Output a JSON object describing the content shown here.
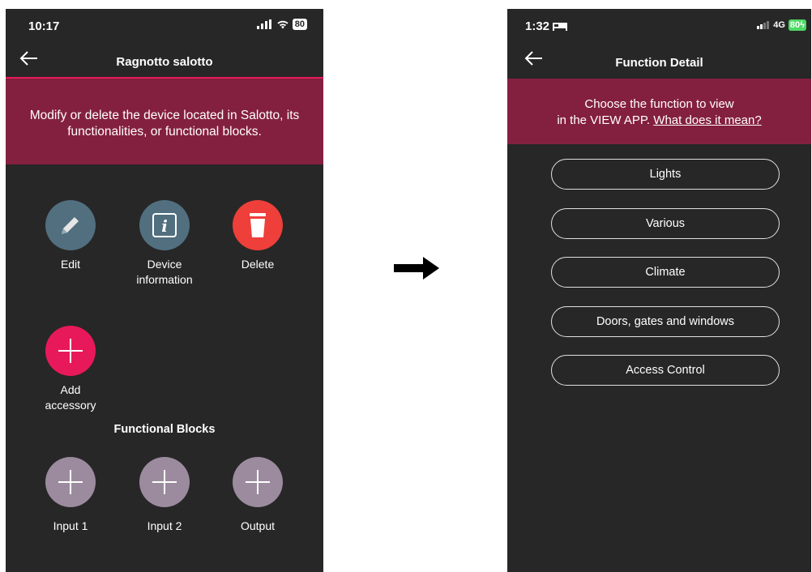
{
  "left_screen": {
    "status": {
      "time": "10:17",
      "battery": "80"
    },
    "header": {
      "title": "Ragnotto salotto"
    },
    "banner": {
      "text": "Modify or delete the device located in Salotto, its functionalities, or functional blocks."
    },
    "actions": [
      {
        "label": "Edit",
        "icon": "pencil-icon",
        "color": "#516f7f"
      },
      {
        "label": "Device information",
        "icon": "info-icon",
        "color": "#516f7f"
      },
      {
        "label": "Delete",
        "icon": "trash-icon",
        "color": "#ee3f3a"
      },
      {
        "label": "Add accessory",
        "icon": "plus-icon",
        "color": "#e8195a"
      }
    ],
    "functional_blocks": {
      "title": "Functional Blocks",
      "items": [
        {
          "label": "Input 1",
          "icon": "plus-icon",
          "color": "#9c8b9e"
        },
        {
          "label": "Input 2",
          "icon": "plus-icon",
          "color": "#9c8b9e"
        },
        {
          "label": "Output",
          "icon": "plus-icon",
          "color": "#9c8b9e"
        }
      ]
    }
  },
  "right_screen": {
    "status": {
      "time": "1:32",
      "network": "4G",
      "battery": "80"
    },
    "header": {
      "title": "Function Detail"
    },
    "banner": {
      "line1": "Choose the function to view",
      "line2_prefix": "in the VIEW APP.",
      "link": "What does it mean?"
    },
    "functions": [
      "Lights",
      "Various",
      "Climate",
      "Doors, gates and windows",
      "Access Control"
    ]
  },
  "colors": {
    "background": "#272727",
    "banner": "#84203f",
    "accent_red": "#e8195a"
  }
}
